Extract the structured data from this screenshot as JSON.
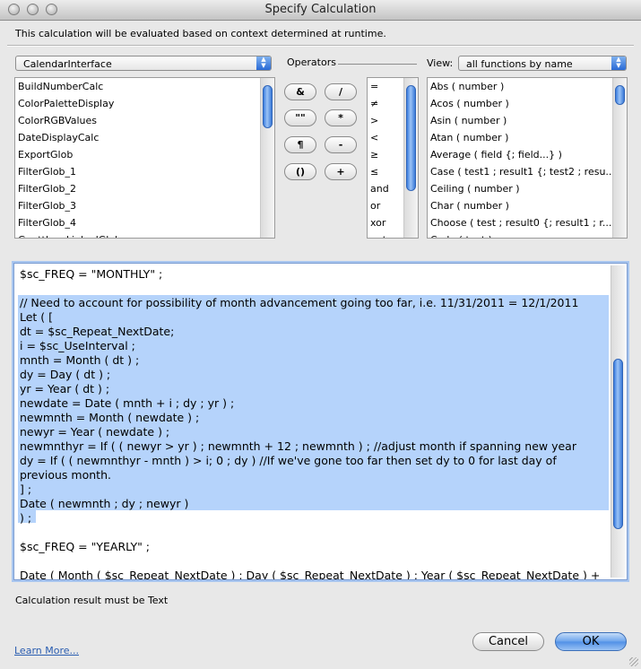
{
  "window": {
    "title": "Specify Calculation"
  },
  "description": "This calculation will be evaluated based on context determined at runtime.",
  "table_selector": {
    "value": "CalendarInterface"
  },
  "fields": [
    "BuildNumberCalc",
    "ColorPaletteDisplay",
    "ColorRGBValues",
    "DateDisplayCalc",
    "ExportGlob",
    "FilterGlob_1",
    "FilterGlob_2",
    "FilterGlob_3",
    "FilterGlob_4",
    "GanttIconLinkedGlob"
  ],
  "operators_label": "Operators",
  "operator_buttons": [
    "&",
    "/",
    "\"\"",
    "*",
    "¶",
    "-",
    "()",
    "+"
  ],
  "operator_list": [
    "=",
    "≠",
    ">",
    "<",
    "≥",
    "≤",
    "and",
    "or",
    "xor",
    "not"
  ],
  "view_label": "View:",
  "view_selector": {
    "value": "all functions by name"
  },
  "functions": [
    "Abs ( number )",
    "Acos ( number )",
    "Asin ( number )",
    "Atan ( number )",
    "Average ( field {; field...} )",
    "Case ( test1 ; result1 {; test2 ; resu...",
    "Ceiling ( number )",
    "Char ( number )",
    "Choose ( test ; result0 {; result1 ; r...",
    "Code ( text )"
  ],
  "code_lines": [
    "$sc_FREQ = \"MONTHLY\" ;",
    "",
    "// Need to account for possibility of month advancement going too far, i.e. 11/31/2011 = 12/1/2011",
    "Let ( [",
    "dt = $sc_Repeat_NextDate;",
    "i = $sc_UseInterval ;",
    "mnth = Month ( dt ) ;",
    "dy = Day ( dt ) ;",
    "yr = Year ( dt ) ;",
    "newdate = Date ( mnth + i  ; dy ; yr ) ;",
    "newmnth = Month ( newdate ) ;",
    "newyr = Year ( newdate ) ;",
    "newmnthyr = If ( ( newyr > yr ) ; newmnth + 12 ; newmnth ) ; //adjust month if spanning new year",
    "dy = If ( ( newmnthyr - mnth ) > i; 0 ; dy ) //If we've gone too far then set dy to 0 for last day of",
    "previous month.",
    "] ;",
    "Date ( newmnth ; dy ; newyr )",
    ") ;",
    "",
    "$sc_FREQ = \"YEARLY\" ;",
    "",
    "Date ( Month ( $sc_Repeat_NextDate )  ; Day ( $sc_Repeat_NextDate ) ; Year ( $sc_Repeat_NextDate ) +"
  ],
  "result_type_text": "Calculation result must be Text",
  "learn_more_link": "Learn More...",
  "buttons": {
    "cancel": "Cancel",
    "ok": "OK"
  },
  "colors": {
    "selection_highlight": "#b5d3fb",
    "accent": "#3b7ad8"
  },
  "icons": {
    "popup_arrows": "up-down-arrows-icon"
  }
}
